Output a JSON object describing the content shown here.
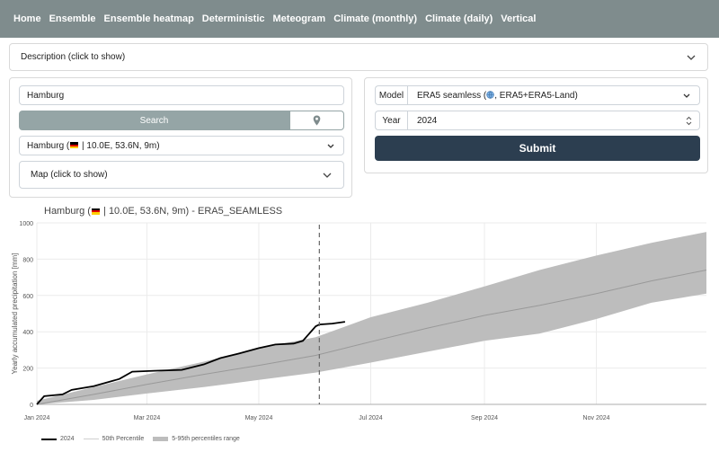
{
  "nav": {
    "items": [
      "Home",
      "Ensemble",
      "Ensemble heatmap",
      "Deterministic",
      "Meteogram",
      "Climate (monthly)",
      "Climate (daily)",
      "Vertical"
    ]
  },
  "description": {
    "label": "Description (click to show)"
  },
  "location": {
    "search_value": "Hamburg",
    "search_button": "Search",
    "selected_before": "Hamburg (",
    "selected_after": " | 10.0E, 53.6N, 9m)",
    "map_toggle": "Map (click to show)"
  },
  "settings": {
    "model_label": "Model",
    "model_before": "ERA5 seamless (",
    "model_after": ", ERA5+ERA5-Land)",
    "year_label": "Year",
    "year_value": "2024",
    "submit": "Submit"
  },
  "colors": {
    "nav": "#7f8c8d",
    "button": "#95a5a6",
    "submit": "#2c3e50",
    "band": "#bdbdbd",
    "median": "#999999",
    "current": "#000000"
  },
  "chart_data": {
    "type": "line",
    "title_before": "Hamburg (",
    "title_after": " | 10.0E, 53.6N, 9m)  -  ERA5_SEAMLESS",
    "ylabel": "Yearly accumulated precipitation [mm]",
    "xlabel": "",
    "ylim": [
      0,
      1000
    ],
    "yticks": [
      "0",
      "200",
      "400",
      "600",
      "800",
      "1000"
    ],
    "xlim": [
      "2024-01-01",
      "2024-12-31"
    ],
    "xticks": [
      {
        "date": "2024-01-01",
        "label": "Jan 2024"
      },
      {
        "date": "2024-03-01",
        "label": "Mar 2024"
      },
      {
        "date": "2024-05-01",
        "label": "May 2024"
      },
      {
        "date": "2024-07-01",
        "label": "Jul 2024"
      },
      {
        "date": "2024-09-01",
        "label": "Sep 2024"
      },
      {
        "date": "2024-11-01",
        "label": "Nov 2024"
      }
    ],
    "grid": true,
    "marker_date": "2024-06-03",
    "legend_position": "bottom-left",
    "legend": [
      "2024",
      "50th Percentile",
      "5-95th percentiles range"
    ],
    "series": [
      {
        "name": "2024",
        "x": [
          "2024-01-01",
          "2024-01-05",
          "2024-01-15",
          "2024-01-20",
          "2024-02-01",
          "2024-02-15",
          "2024-02-22",
          "2024-03-05",
          "2024-03-20",
          "2024-04-01",
          "2024-04-10",
          "2024-04-20",
          "2024-05-01",
          "2024-05-10",
          "2024-05-20",
          "2024-05-25",
          "2024-06-01",
          "2024-06-03",
          "2024-06-10",
          "2024-06-17"
        ],
        "y": [
          0,
          45,
          55,
          80,
          100,
          140,
          180,
          185,
          190,
          220,
          255,
          280,
          310,
          330,
          335,
          350,
          430,
          440,
          445,
          455
        ]
      },
      {
        "name": "50th Percentile",
        "x": [
          "2024-01-01",
          "2024-02-01",
          "2024-03-01",
          "2024-04-01",
          "2024-05-01",
          "2024-06-01",
          "2024-07-01",
          "2024-08-01",
          "2024-09-01",
          "2024-10-01",
          "2024-11-01",
          "2024-12-01",
          "2024-12-31"
        ],
        "y": [
          0,
          55,
          110,
          165,
          215,
          270,
          345,
          420,
          490,
          545,
          610,
          680,
          740
        ]
      },
      {
        "name": "5th Percentile",
        "x": [
          "2024-01-01",
          "2024-02-01",
          "2024-03-01",
          "2024-04-01",
          "2024-05-01",
          "2024-06-01",
          "2024-07-01",
          "2024-08-01",
          "2024-09-01",
          "2024-10-01",
          "2024-11-01",
          "2024-12-01",
          "2024-12-31"
        ],
        "y": [
          0,
          25,
          60,
          95,
          135,
          175,
          230,
          290,
          350,
          390,
          470,
          560,
          610
        ]
      },
      {
        "name": "95th Percentile",
        "x": [
          "2024-01-01",
          "2024-02-01",
          "2024-03-01",
          "2024-04-01",
          "2024-05-01",
          "2024-06-01",
          "2024-07-01",
          "2024-08-01",
          "2024-09-01",
          "2024-10-01",
          "2024-11-01",
          "2024-12-01",
          "2024-12-31"
        ],
        "y": [
          20,
          95,
          165,
          235,
          310,
          370,
          480,
          560,
          650,
          740,
          820,
          890,
          950
        ]
      }
    ]
  }
}
